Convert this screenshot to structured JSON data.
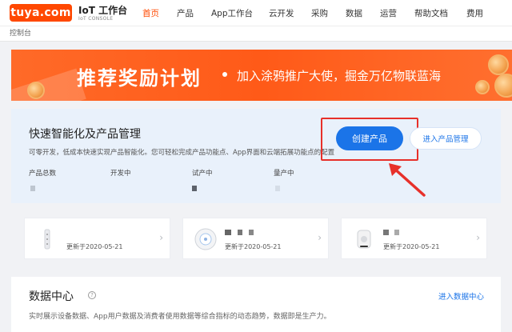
{
  "header": {
    "logo_text": "tuya.com",
    "console_title": "IoT 工作台",
    "console_sub": "IoT CONSOLE",
    "nav": [
      {
        "label": "首页",
        "active": true
      },
      {
        "label": "产品"
      },
      {
        "label": "App工作台"
      },
      {
        "label": "云开发"
      },
      {
        "label": "采购"
      },
      {
        "label": "数据"
      },
      {
        "label": "运营"
      },
      {
        "label": "帮助文档"
      },
      {
        "label": "费用"
      }
    ]
  },
  "breadcrumb": "控制台",
  "banner": {
    "title": "推荐奖励计划",
    "subtitle": "加入涂鸦推广大使，掘金万亿物联蓝海"
  },
  "product_management": {
    "title": "快速智能化及产品管理",
    "description": "可零开发，低成本快速实现产品智能化。您可轻松完成产品功能点、App界面和云端拓展功能点的配置",
    "create_button": "创建产品",
    "enter_button": "进入产品管理",
    "stats": [
      {
        "label": "产品总数"
      },
      {
        "label": "开发中"
      },
      {
        "label": "试产中"
      },
      {
        "label": "量产中"
      }
    ]
  },
  "products": [
    {
      "updated": "更新于2020-05-21",
      "icon": "device-strip-icon"
    },
    {
      "updated": "更新于2020-05-21",
      "icon": "round-device-icon"
    },
    {
      "updated": "更新于2020-05-21",
      "icon": "speaker-device-icon"
    }
  ],
  "data_center": {
    "title": "数据中心",
    "help_icon": "?",
    "link": "进入数据中心",
    "description": "实时展示设备数据、App用户数据及消费者使用数据等综合指标的动态趋势，数据即是生产力。"
  },
  "colors": {
    "brand": "#ff4800",
    "primary_blue": "#1b74e8",
    "highlight_red": "#e7302a"
  }
}
